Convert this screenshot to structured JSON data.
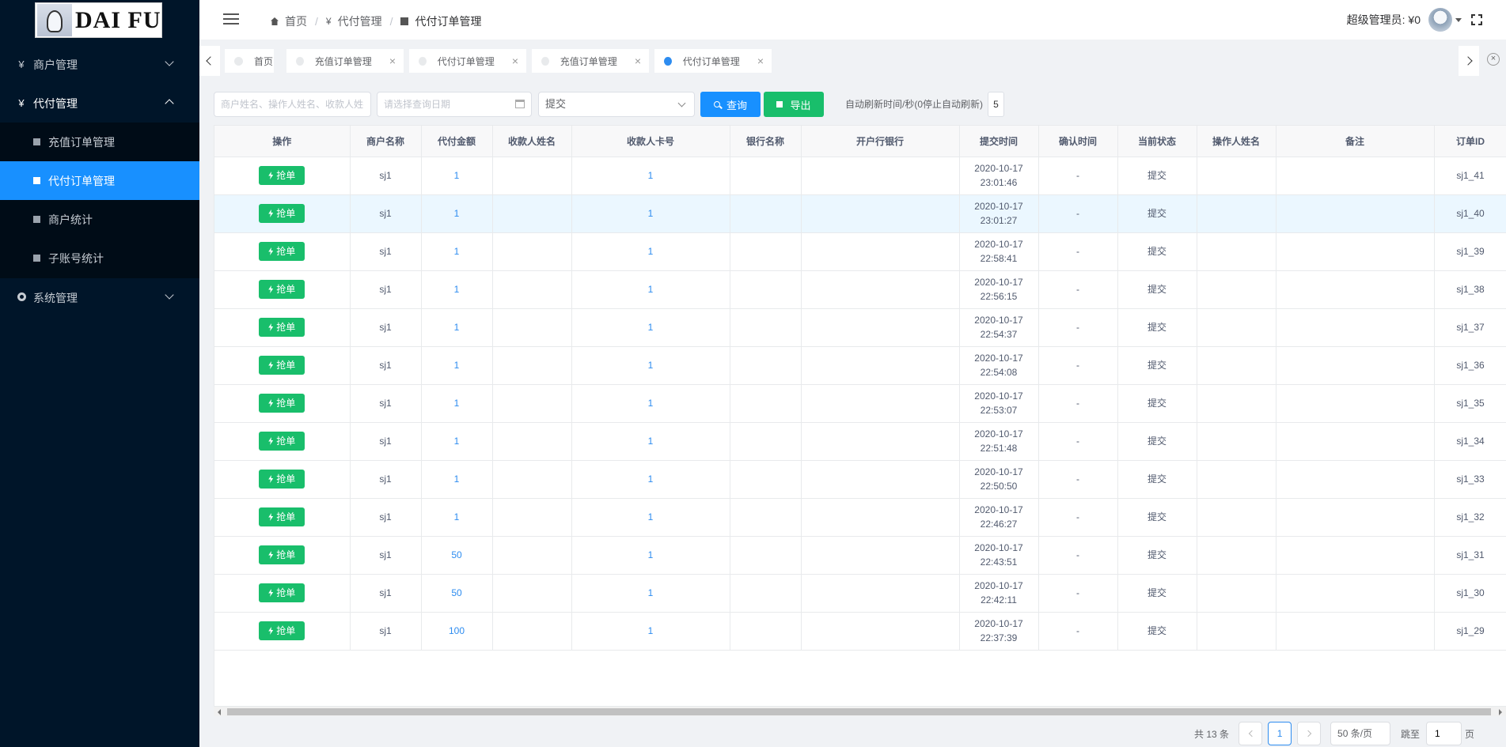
{
  "sidebar": {
    "logo_text": "DAI FU",
    "menu": [
      {
        "label": "商户管理",
        "icon": "yen-icon"
      },
      {
        "label": "代付管理",
        "icon": "yen-icon"
      },
      {
        "label": "系统管理",
        "icon": "gear-icon"
      }
    ],
    "submenu": [
      {
        "label": "充值订单管理"
      },
      {
        "label": "代付订单管理",
        "active": true
      },
      {
        "label": "商户统计"
      },
      {
        "label": "子账号统计"
      }
    ]
  },
  "header": {
    "breadcrumb": [
      "首页",
      "代付管理",
      "代付订单管理"
    ],
    "user_label": "超级管理员: ¥0"
  },
  "tabs": [
    {
      "label": "首页"
    },
    {
      "label": "充值订单管理"
    },
    {
      "label": "代付订单管理"
    },
    {
      "label": "充值订单管理"
    },
    {
      "label": "代付订单管理",
      "active": true
    }
  ],
  "filters": {
    "name_placeholder": "商户姓名、操作人姓名、收款人姓名",
    "date_placeholder": "请选择查询日期",
    "status_value": "提交",
    "query_label": "查询",
    "export_label": "导出",
    "refresh_label": "自动刷新时间/秒(0停止自动刷新)",
    "refresh_value": "5"
  },
  "table": {
    "columns": [
      "操作",
      "商户名称",
      "代付金额",
      "收款人姓名",
      "收款人卡号",
      "银行名称",
      "开户行银行",
      "提交时间",
      "确认时间",
      "当前状态",
      "操作人姓名",
      "备注",
      "订单ID"
    ],
    "action_label": "抢单",
    "rows": [
      {
        "merchant": "sj1",
        "amount": "1",
        "payee": "",
        "card": "1",
        "bank": "",
        "branch": "",
        "date": "2020-10-17",
        "time": "23:01:46",
        "confirm": "-",
        "status": "提交",
        "operator": "",
        "remark": "",
        "id": "sj1_41"
      },
      {
        "merchant": "sj1",
        "amount": "1",
        "payee": "",
        "card": "1",
        "bank": "",
        "branch": "",
        "date": "2020-10-17",
        "time": "23:01:27",
        "confirm": "-",
        "status": "提交",
        "operator": "",
        "remark": "",
        "id": "sj1_40"
      },
      {
        "merchant": "sj1",
        "amount": "1",
        "payee": "",
        "card": "1",
        "bank": "",
        "branch": "",
        "date": "2020-10-17",
        "time": "22:58:41",
        "confirm": "-",
        "status": "提交",
        "operator": "",
        "remark": "",
        "id": "sj1_39"
      },
      {
        "merchant": "sj1",
        "amount": "1",
        "payee": "",
        "card": "1",
        "bank": "",
        "branch": "",
        "date": "2020-10-17",
        "time": "22:56:15",
        "confirm": "-",
        "status": "提交",
        "operator": "",
        "remark": "",
        "id": "sj1_38"
      },
      {
        "merchant": "sj1",
        "amount": "1",
        "payee": "",
        "card": "1",
        "bank": "",
        "branch": "",
        "date": "2020-10-17",
        "time": "22:54:37",
        "confirm": "-",
        "status": "提交",
        "operator": "",
        "remark": "",
        "id": "sj1_37"
      },
      {
        "merchant": "sj1",
        "amount": "1",
        "payee": "",
        "card": "1",
        "bank": "",
        "branch": "",
        "date": "2020-10-17",
        "time": "22:54:08",
        "confirm": "-",
        "status": "提交",
        "operator": "",
        "remark": "",
        "id": "sj1_36"
      },
      {
        "merchant": "sj1",
        "amount": "1",
        "payee": "",
        "card": "1",
        "bank": "",
        "branch": "",
        "date": "2020-10-17",
        "time": "22:53:07",
        "confirm": "-",
        "status": "提交",
        "operator": "",
        "remark": "",
        "id": "sj1_35"
      },
      {
        "merchant": "sj1",
        "amount": "1",
        "payee": "",
        "card": "1",
        "bank": "",
        "branch": "",
        "date": "2020-10-17",
        "time": "22:51:48",
        "confirm": "-",
        "status": "提交",
        "operator": "",
        "remark": "",
        "id": "sj1_34"
      },
      {
        "merchant": "sj1",
        "amount": "1",
        "payee": "",
        "card": "1",
        "bank": "",
        "branch": "",
        "date": "2020-10-17",
        "time": "22:50:50",
        "confirm": "-",
        "status": "提交",
        "operator": "",
        "remark": "",
        "id": "sj1_33"
      },
      {
        "merchant": "sj1",
        "amount": "1",
        "payee": "",
        "card": "1",
        "bank": "",
        "branch": "",
        "date": "2020-10-17",
        "time": "22:46:27",
        "confirm": "-",
        "status": "提交",
        "operator": "",
        "remark": "",
        "id": "sj1_32"
      },
      {
        "merchant": "sj1",
        "amount": "50",
        "payee": "",
        "card": "1",
        "bank": "",
        "branch": "",
        "date": "2020-10-17",
        "time": "22:43:51",
        "confirm": "-",
        "status": "提交",
        "operator": "",
        "remark": "",
        "id": "sj1_31"
      },
      {
        "merchant": "sj1",
        "amount": "50",
        "payee": "",
        "card": "1",
        "bank": "",
        "branch": "",
        "date": "2020-10-17",
        "time": "22:42:11",
        "confirm": "-",
        "status": "提交",
        "operator": "",
        "remark": "",
        "id": "sj1_30"
      },
      {
        "merchant": "sj1",
        "amount": "100",
        "payee": "",
        "card": "1",
        "bank": "",
        "branch": "",
        "date": "2020-10-17",
        "time": "22:37:39",
        "confirm": "-",
        "status": "提交",
        "operator": "",
        "remark": "",
        "id": "sj1_29"
      }
    ]
  },
  "pagination": {
    "total": "共 13 条",
    "current_page": "1",
    "page_size": "50 条/页",
    "jump_label": "跳至",
    "jump_value": "1",
    "jump_suffix": "页"
  },
  "colors": {
    "sidebar_bg": "#001529",
    "accent": "#1890ff",
    "success": "#19be6b",
    "link": "#2d8cf0"
  }
}
